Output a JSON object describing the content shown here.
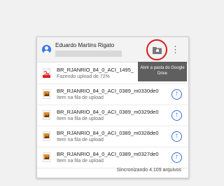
{
  "user": {
    "name": "Eduardo Martins Rigato"
  },
  "tooltip": {
    "text": "Abrir a pasta do Google Drive"
  },
  "files": [
    {
      "name": "BR_RJANRIO_84_0_ACI_1495_",
      "status": "Fazendo upload de 72%",
      "icon": "pdf-file-icon",
      "action": "spinner"
    },
    {
      "name": "BR_RJANRIO_84_0_ACI_0389_m0330de0",
      "status": "Item na fila de upload",
      "icon": "image-file-icon",
      "action": "upload"
    },
    {
      "name": "BR_RJANRIO_84_0_ACI_0389_m0329de0",
      "status": "Item na fila de upload",
      "icon": "image-file-icon",
      "action": "upload"
    },
    {
      "name": "BR_RJANRIO_84_0_ACI_0389_m0328de0",
      "status": "Item na fila de upload",
      "icon": "image-file-icon",
      "action": "upload"
    },
    {
      "name": "BR_RJANRIO_84_0_ACI_0389_m0327de0",
      "status": "Item na fila de upload",
      "icon": "image-file-icon",
      "action": "upload"
    }
  ],
  "footer": {
    "sync_text": "Sincronizando 4.109 arquivos"
  },
  "colors": {
    "accent": "#2f6fe0",
    "highlight_circle": "#d81b1b",
    "tooltip_bg": "#5f5f5f"
  }
}
